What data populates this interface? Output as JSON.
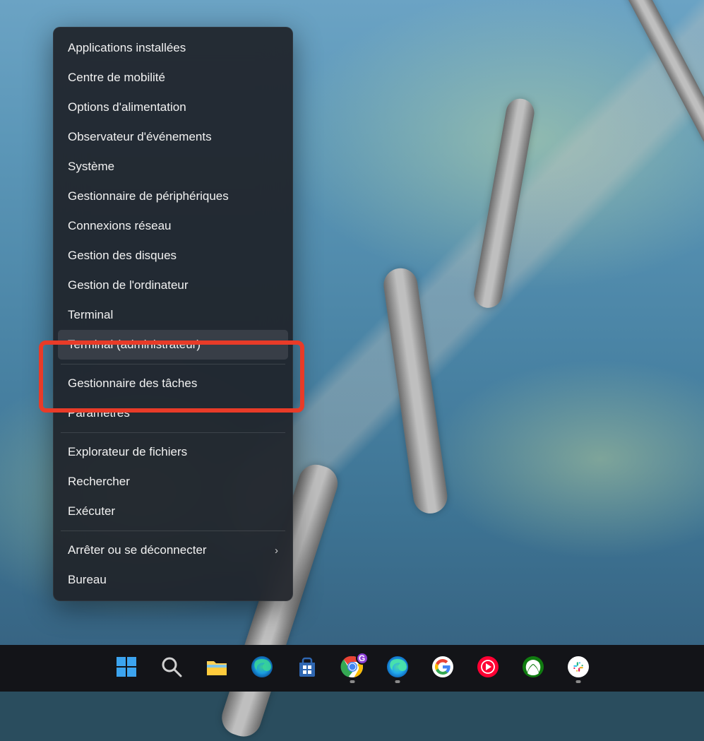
{
  "menu": {
    "groups": [
      [
        {
          "id": "installed-apps",
          "label": "Applications installées"
        },
        {
          "id": "mobility-center",
          "label": "Centre de mobilité"
        },
        {
          "id": "power-options",
          "label": "Options d'alimentation"
        },
        {
          "id": "event-viewer",
          "label": "Observateur d'événements"
        },
        {
          "id": "system",
          "label": "Système"
        },
        {
          "id": "device-manager",
          "label": "Gestionnaire de périphériques"
        },
        {
          "id": "network-connections",
          "label": "Connexions réseau"
        },
        {
          "id": "disk-management",
          "label": "Gestion des disques"
        },
        {
          "id": "computer-management",
          "label": "Gestion de l'ordinateur"
        },
        {
          "id": "terminal",
          "label": "Terminal"
        },
        {
          "id": "terminal-admin",
          "label": "Terminal (administrateur)",
          "selected": true,
          "highlighted": true
        }
      ],
      [
        {
          "id": "task-manager",
          "label": "Gestionnaire des tâches"
        },
        {
          "id": "settings",
          "label": "Paramètres"
        }
      ],
      [
        {
          "id": "file-explorer",
          "label": "Explorateur de fichiers"
        },
        {
          "id": "search",
          "label": "Rechercher"
        },
        {
          "id": "run",
          "label": "Exécuter"
        }
      ],
      [
        {
          "id": "shutdown-signout",
          "label": "Arrêter ou se déconnecter",
          "hasSubmenu": true
        },
        {
          "id": "desktop",
          "label": "Bureau"
        }
      ]
    ]
  },
  "taskbar": {
    "icons": [
      {
        "id": "start",
        "name": "start-icon",
        "indicator": false
      },
      {
        "id": "search",
        "name": "search-icon",
        "indicator": false
      },
      {
        "id": "file-explorer",
        "name": "file-explorer-icon",
        "indicator": false
      },
      {
        "id": "edge",
        "name": "edge-icon",
        "indicator": false
      },
      {
        "id": "microsoft-store",
        "name": "store-icon",
        "indicator": false
      },
      {
        "id": "chrome",
        "name": "chrome-icon",
        "indicator": true,
        "badge": "G"
      },
      {
        "id": "edge-canary",
        "name": "edge-canary-icon",
        "indicator": true
      },
      {
        "id": "google",
        "name": "google-icon",
        "indicator": false
      },
      {
        "id": "youtube-music",
        "name": "youtube-music-icon",
        "indicator": false
      },
      {
        "id": "xbox",
        "name": "xbox-icon",
        "indicator": false
      },
      {
        "id": "slack",
        "name": "slack-icon",
        "indicator": true
      }
    ]
  }
}
